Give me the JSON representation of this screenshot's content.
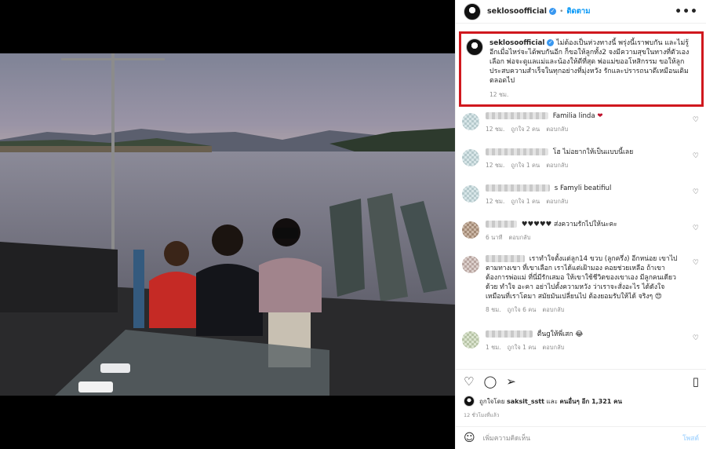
{
  "post": {
    "username": "seklosoofficial",
    "follow_label": "ติดตาม",
    "more_label": "•••",
    "caption_username": "seklosoofficial",
    "caption": "ไม่ต้องเป็นห่วงทางนี้ พรุ่งนี้เราพบกัน และไม่รู้อีกเมื่อไหร่จะได้พบกันอีก ก็ขอให้ลูกทั้ง2 จงมีความสุขในทางที่ตัวเองเลือก พ่อจะดูแลแม่และน้องให้ดีที่สุด พ่อแม่ขออโหสิกรรม ขอให้ลูกประสบความสำเร็จในทุกอย่างที่มุ่งหวัง รักและปรารถนาดีเหมือนเดิมตลอดไป",
    "caption_time": "12 ชม."
  },
  "comments": [
    {
      "text": "Familia linda",
      "emoji": "❤",
      "time": "12 ชม.",
      "likes": "ถูกใจ 2 คน",
      "reply": "ตอบกลับ",
      "blur_w": 80
    },
    {
      "text": "โฮ ไม่อยากให้เป็นแบบนี้เลย",
      "emoji": "",
      "time": "12 ชม.",
      "likes": "ถูกใจ 1 คน",
      "reply": "ตอบกลับ",
      "blur_w": 80
    },
    {
      "text": "s Famyli beatifiul",
      "emoji": "",
      "time": "12 ชม.",
      "likes": "ถูกใจ 1 คน",
      "reply": "ตอบกลับ",
      "blur_w": 82
    },
    {
      "text": "♥♥♥♥♥ ส่งความรักไปให้นะคะ",
      "emoji": "",
      "time": "6 นาที",
      "likes": "",
      "reply": "ตอบกลับ",
      "blur_w": 40
    },
    {
      "text": "เราทำใจตั้งแต่ลูก14 ขวบ (ลูกครึ่ง) อีกหน่อย เขาไปตามทางเขา ที่เขาเลือก เราได้แต่เฝ้ามอง คอยช่วยเหลือ ถ้าเขาต้องการพ่อแม่ ที่นี่มีรักเสมอ ให้เขาใช้ชีวิตของเขาเอง มีลูกคนเดียวด้วย ทำใจ อะคา อย่าไปตั้งความหวัง ว่าเราจะสั่งอะไร ได้ดังใจ เหมือนที่เราโตมา สมัยมันเปลี่ยนไป ต้องยอมรับให้ได้ จริงๆ",
      "emoji": "😍",
      "time": "8 ชม.",
      "likes": "ถูกใจ 6 คน",
      "reply": "ตอบกลับ",
      "blur_w": 50
    },
    {
      "text": "ตื่นgให้พี่เสก",
      "emoji": "😂",
      "time": "1 ชม.",
      "likes": "ถูกใจ 1 คน",
      "reply": "ตอบกลับ",
      "blur_w": 60
    }
  ],
  "actions": {
    "like_icon": "heart-outline-icon",
    "comment_icon": "comment-icon",
    "share_icon": "paper-plane-icon",
    "save_icon": "bookmark-icon"
  },
  "likes_line": {
    "prefix": "ถูกใจโดย",
    "user": "saksit_sstt",
    "mid": "และ",
    "others": "คนอื่นๆ อีก 1,321 คน"
  },
  "post_time": "12 ชั่วโมงที่แล้ว",
  "add_comment": {
    "placeholder": "เพิ่มความคิดเห็น",
    "post_label": "โพสต์"
  },
  "colors": {
    "highlight_border": "#d0181e",
    "link_blue": "#0095f6",
    "verified_blue": "#3897f0"
  }
}
